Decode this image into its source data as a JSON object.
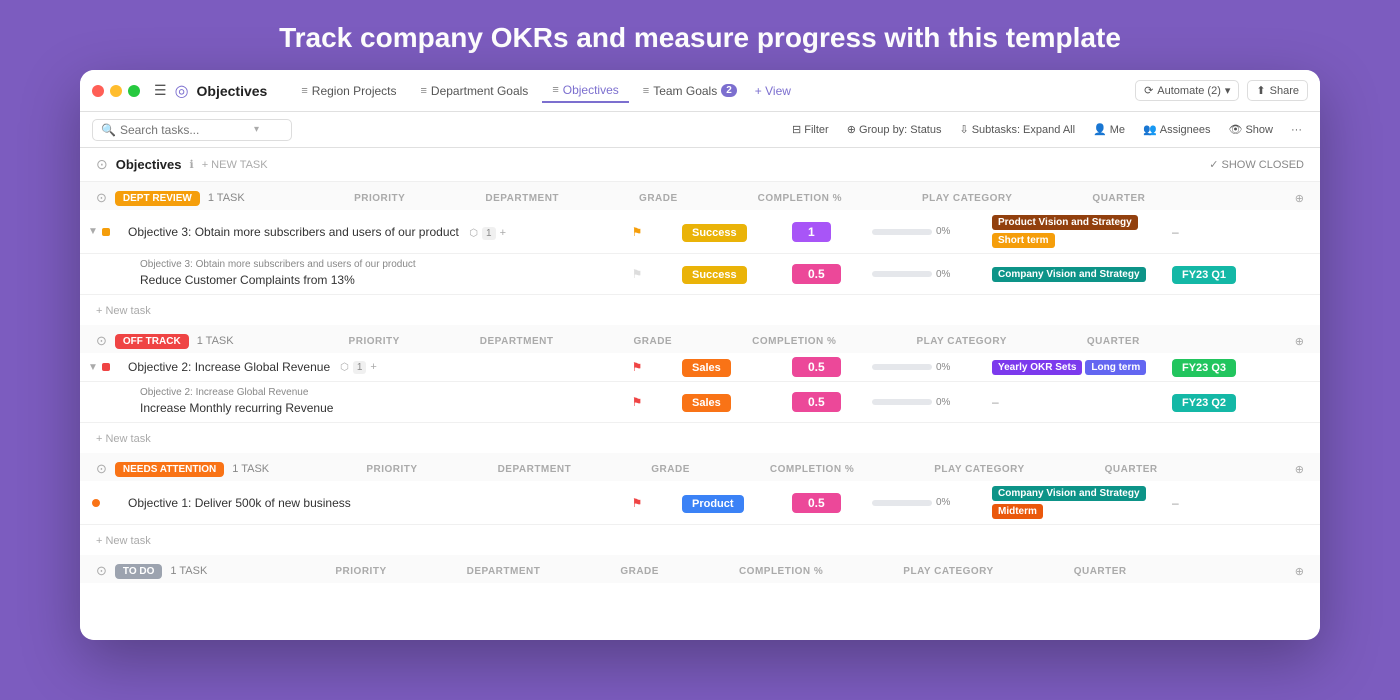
{
  "headline": "Track company OKRs and measure progress with this template",
  "titlebar": {
    "app_title": "Objectives",
    "nav_tabs": [
      {
        "label": "Region Projects",
        "icon": "≡",
        "active": false
      },
      {
        "label": "Department Goals",
        "icon": "≡",
        "active": false
      },
      {
        "label": "Objectives",
        "icon": "≡",
        "active": true
      },
      {
        "label": "Team Goals",
        "icon": "≡",
        "active": false,
        "badge": "2"
      },
      {
        "label": "+ View",
        "icon": "",
        "active": false
      }
    ],
    "automate_label": "Automate (2)",
    "share_label": "Share"
  },
  "toolbar": {
    "search_placeholder": "Search tasks...",
    "filter_label": "Filter",
    "group_by_label": "Group by: Status",
    "subtasks_label": "Subtasks: Expand All",
    "me_label": "Me",
    "assignees_label": "Assignees",
    "show_label": "Show"
  },
  "objectives_header": {
    "title": "Objectives",
    "new_task_label": "+ NEW TASK",
    "show_closed_label": "✓ SHOW CLOSED"
  },
  "col_headers": [
    "",
    "PRIORITY",
    "DEPARTMENT",
    "GRADE",
    "COMPLETION %",
    "PLAY CATEGORY",
    "QUARTER",
    ""
  ],
  "sections": [
    {
      "id": "dept-review",
      "status": "DEPT REVIEW",
      "badge_class": "badge-dept-review",
      "count": "1 TASK",
      "tasks": [
        {
          "indent": 1,
          "color": "#f59e0b",
          "name": "Objective 3: Obtain more subscribers and users of our product",
          "sub_label": "",
          "subtask_count": "1",
          "priority": "yellow",
          "dept": "Success",
          "dept_class": "dept-success",
          "grade": "1",
          "grade_class": "grade-purple",
          "completion": 0,
          "tags": [
            "Product Vision and Strategy",
            "Short term"
          ],
          "tag_classes": [
            "tag-brown",
            "tag-short"
          ],
          "quarter": "",
          "quarter_class": ""
        },
        {
          "indent": 2,
          "color": "#9ca3af",
          "name": "Reduce Customer Complaints from 13%",
          "sub_label": "Objective 3: Obtain more subscribers and users of our product",
          "subtask_count": "",
          "priority": "grey",
          "dept": "Success",
          "dept_class": "dept-success",
          "grade": "0.5",
          "grade_class": "grade-pink",
          "completion": 0,
          "tags": [
            "Company Vision and Strategy"
          ],
          "tag_classes": [
            "tag-teal"
          ],
          "quarter": "FY23 Q1",
          "quarter_class": "q-teal"
        }
      ]
    },
    {
      "id": "off-track",
      "status": "OFF TRACK",
      "badge_class": "badge-off-track",
      "count": "1 TASK",
      "tasks": [
        {
          "indent": 1,
          "color": "#ef4444",
          "name": "Objective 2: Increase Global Revenue",
          "sub_label": "",
          "subtask_count": "1",
          "priority": "red",
          "dept": "Sales",
          "dept_class": "dept-sales",
          "grade": "0.5",
          "grade_class": "grade-pink",
          "completion": 0,
          "tags": [
            "Yearly OKR Sets",
            "Long term"
          ],
          "tag_classes": [
            "tag-yearly",
            "tag-long"
          ],
          "quarter": "FY23 Q3",
          "quarter_class": "q-green"
        },
        {
          "indent": 2,
          "color": "#9ca3af",
          "name": "Increase Monthly recurring Revenue",
          "sub_label": "Objective 2: Increase Global Revenue",
          "subtask_count": "",
          "priority": "red",
          "dept": "Sales",
          "dept_class": "dept-sales",
          "grade": "0.5",
          "grade_class": "grade-pink",
          "completion": 0,
          "tags": [],
          "tag_classes": [],
          "quarter": "FY23 Q2",
          "quarter_class": "q-teal"
        }
      ]
    },
    {
      "id": "needs-attention",
      "status": "NEEDS ATTENTION",
      "badge_class": "badge-needs-attention",
      "count": "1 TASK",
      "tasks": [
        {
          "indent": 1,
          "color": "#f97316",
          "name": "Objective 1: Deliver 500k of new business",
          "sub_label": "",
          "subtask_count": "",
          "priority": "red",
          "dept": "Product",
          "dept_class": "dept-product",
          "grade": "0.5",
          "grade_class": "grade-pink",
          "completion": 0,
          "tags": [
            "Company Vision and Strategy",
            "Midterm"
          ],
          "tag_classes": [
            "tag-teal",
            "tag-midterm"
          ],
          "quarter": "",
          "quarter_class": ""
        }
      ]
    },
    {
      "id": "to-do",
      "status": "TO DO",
      "badge_class": "badge-to-do",
      "count": "1 TASK",
      "tasks": []
    }
  ],
  "new_task_label": "+ New task"
}
